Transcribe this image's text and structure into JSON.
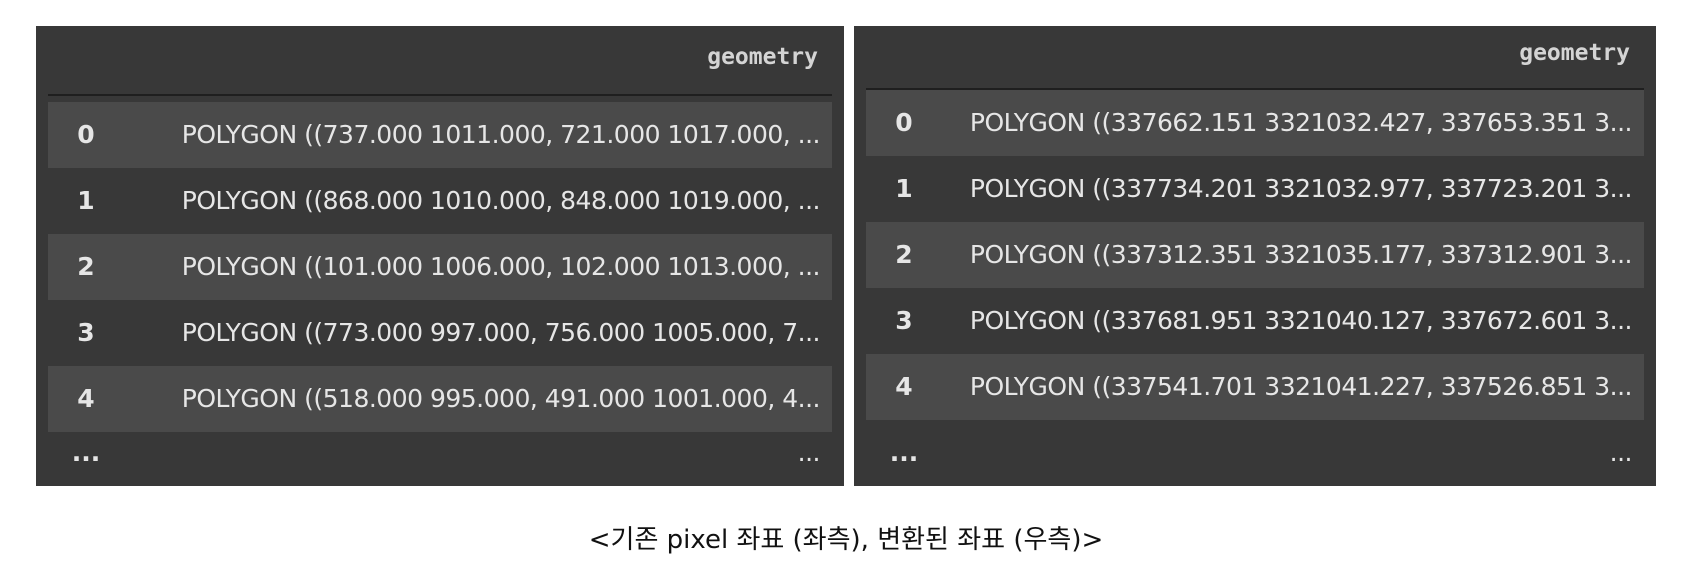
{
  "left_table": {
    "column": "geometry",
    "rows": [
      {
        "index": "0",
        "value": "POLYGON ((737.000 1011.000, 721.000 1017.000, ..."
      },
      {
        "index": "1",
        "value": "POLYGON ((868.000 1010.000, 848.000 1019.000, ..."
      },
      {
        "index": "2",
        "value": "POLYGON ((101.000 1006.000, 102.000 1013.000, ..."
      },
      {
        "index": "3",
        "value": "POLYGON ((773.000 997.000, 756.000 1005.000, 7..."
      },
      {
        "index": "4",
        "value": "POLYGON ((518.000 995.000, 491.000 1001.000, 4..."
      }
    ],
    "ellipsis_index": "...",
    "ellipsis_value": "..."
  },
  "right_table": {
    "column": "geometry",
    "rows": [
      {
        "index": "0",
        "value": "POLYGON ((337662.151 3321032.427, 337653.351 3..."
      },
      {
        "index": "1",
        "value": "POLYGON ((337734.201 3321032.977, 337723.201 3..."
      },
      {
        "index": "2",
        "value": "POLYGON ((337312.351 3321035.177, 337312.901 3..."
      },
      {
        "index": "3",
        "value": "POLYGON ((337681.951 3321040.127, 337672.601 3..."
      },
      {
        "index": "4",
        "value": "POLYGON ((337541.701 3321041.227, 337526.851 3..."
      }
    ],
    "ellipsis_index": "...",
    "ellipsis_value": "..."
  },
  "caption": "<기존 pixel 좌표 (좌측), 변환된 좌표 (우측)>",
  "colors": {
    "panel_bg": "#383838",
    "row_shade": "#4a4a4a",
    "text": "#e6e6e6"
  }
}
